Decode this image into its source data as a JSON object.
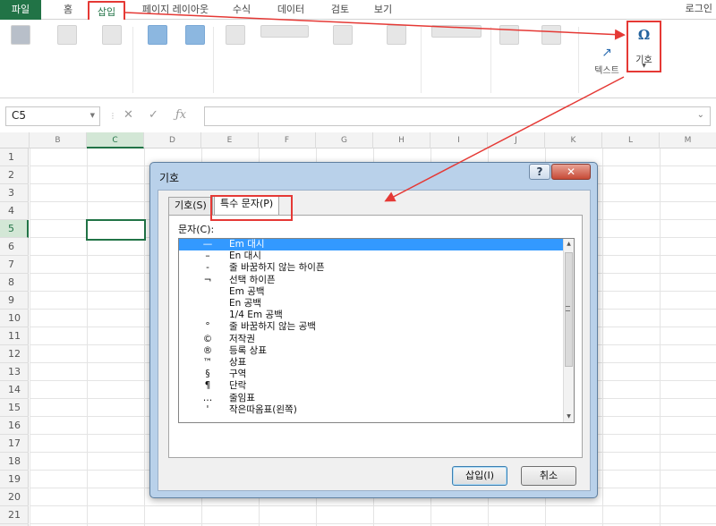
{
  "ribbon_tabs": [
    {
      "label": "파일"
    },
    {
      "label": "홈"
    },
    {
      "label": "삽입"
    },
    {
      "label": "페이지 레이아웃"
    },
    {
      "label": "수식"
    },
    {
      "label": "데이터"
    },
    {
      "label": "검토"
    },
    {
      "label": "보기"
    }
  ],
  "login_label": "로그인",
  "ribbon": {
    "text_label": "텍스트",
    "symbol_label": "기호",
    "symbol_glyph": "Ω"
  },
  "formula_bar": {
    "name_box": "C5"
  },
  "columns": [
    "B",
    "C",
    "D",
    "E",
    "F",
    "G",
    "H",
    "I",
    "J",
    "K",
    "L",
    "M"
  ],
  "rows": [
    "1",
    "2",
    "3",
    "4",
    "5",
    "6",
    "7",
    "8",
    "9",
    "10",
    "11",
    "12",
    "13",
    "14",
    "15",
    "16",
    "17",
    "18",
    "19",
    "20",
    "21"
  ],
  "selected_column": "C",
  "selected_row": "5",
  "dialog": {
    "title": "기호",
    "help_glyph": "?",
    "close_glyph": "✕",
    "tabs": [
      {
        "label": "기호(S)"
      },
      {
        "label": "특수 문자(P)"
      }
    ],
    "list_label": "문자(C):",
    "characters": [
      {
        "glyph": "—",
        "name": "Em 대시"
      },
      {
        "glyph": "–",
        "name": "En 대시"
      },
      {
        "glyph": "-",
        "name": "줄 바꿈하지 않는 하이픈"
      },
      {
        "glyph": "¬",
        "name": "선택 하이픈"
      },
      {
        "glyph": "",
        "name": "Em 공백"
      },
      {
        "glyph": "",
        "name": "En 공백"
      },
      {
        "glyph": "",
        "name": "1/4 Em 공백"
      },
      {
        "glyph": "°",
        "name": "줄 바꿈하지 않는 공백"
      },
      {
        "glyph": "©",
        "name": "저작권"
      },
      {
        "glyph": "®",
        "name": "등록 상표"
      },
      {
        "glyph": "™",
        "name": "상표"
      },
      {
        "glyph": "§",
        "name": "구역"
      },
      {
        "glyph": "¶",
        "name": "단락"
      },
      {
        "glyph": "…",
        "name": "줄임표"
      },
      {
        "glyph": "'",
        "name": "작은따옴표(왼쪽)"
      }
    ],
    "insert_button": "삽입(I)",
    "cancel_button": "취소"
  },
  "colors": {
    "excel_green": "#217346",
    "highlight_red": "#e53935",
    "selection_blue": "#3399ff"
  }
}
